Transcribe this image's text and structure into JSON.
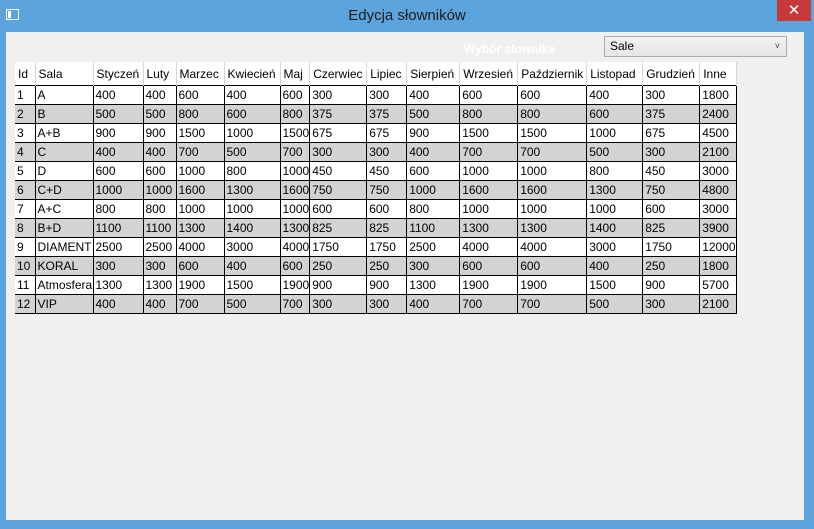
{
  "window": {
    "title": "Edycja słowników",
    "close_glyph": "✕"
  },
  "dictionary": {
    "label": "Wybór słownika",
    "selected": "Sale",
    "chevron": "˅"
  },
  "table": {
    "columns": [
      "Id",
      "Sala",
      "Styczeń",
      "Luty",
      "Marzec",
      "Kwiecień",
      "Maj",
      "Czerwiec",
      "Lipiec",
      "Sierpień",
      "Wrzesień",
      "Październik",
      "Listopad",
      "Grudzień",
      "Inne"
    ],
    "rows": [
      [
        "1",
        "A",
        "400",
        "400",
        "600",
        "400",
        "600",
        "300",
        "300",
        "400",
        "600",
        "600",
        "400",
        "300",
        "1800"
      ],
      [
        "2",
        "B",
        "500",
        "500",
        "800",
        "600",
        "800",
        "375",
        "375",
        "500",
        "800",
        "800",
        "600",
        "375",
        "2400"
      ],
      [
        "3",
        "A+B",
        "900",
        "900",
        "1500",
        "1000",
        "1500",
        "675",
        "675",
        "900",
        "1500",
        "1500",
        "1000",
        "675",
        "4500"
      ],
      [
        "4",
        "C",
        "400",
        "400",
        "700",
        "500",
        "700",
        "300",
        "300",
        "400",
        "700",
        "700",
        "500",
        "300",
        "2100"
      ],
      [
        "5",
        "D",
        "600",
        "600",
        "1000",
        "800",
        "1000",
        "450",
        "450",
        "600",
        "1000",
        "1000",
        "800",
        "450",
        "3000"
      ],
      [
        "6",
        "C+D",
        "1000",
        "1000",
        "1600",
        "1300",
        "1600",
        "750",
        "750",
        "1000",
        "1600",
        "1600",
        "1300",
        "750",
        "4800"
      ],
      [
        "7",
        "A+C",
        "800",
        "800",
        "1000",
        "1000",
        "1000",
        "600",
        "600",
        "800",
        "1000",
        "1000",
        "1000",
        "600",
        "3000"
      ],
      [
        "8",
        "B+D",
        "1100",
        "1100",
        "1300",
        "1400",
        "1300",
        "825",
        "825",
        "1100",
        "1300",
        "1300",
        "1400",
        "825",
        "3900"
      ],
      [
        "9",
        "DIAMENT",
        "2500",
        "2500",
        "4000",
        "3000",
        "4000",
        "1750",
        "1750",
        "2500",
        "4000",
        "4000",
        "3000",
        "1750",
        "12000"
      ],
      [
        "10",
        "KORAL",
        "300",
        "300",
        "600",
        "400",
        "600",
        "250",
        "250",
        "300",
        "600",
        "600",
        "400",
        "250",
        "1800"
      ],
      [
        "11",
        "Atmosfera",
        "1300",
        "1300",
        "1900",
        "1500",
        "1900",
        "900",
        "900",
        "1300",
        "1900",
        "1900",
        "1500",
        "900",
        "5700"
      ],
      [
        "12",
        "VIP",
        "400",
        "400",
        "700",
        "500",
        "700",
        "300",
        "300",
        "400",
        "700",
        "700",
        "500",
        "300",
        "2100"
      ]
    ]
  }
}
